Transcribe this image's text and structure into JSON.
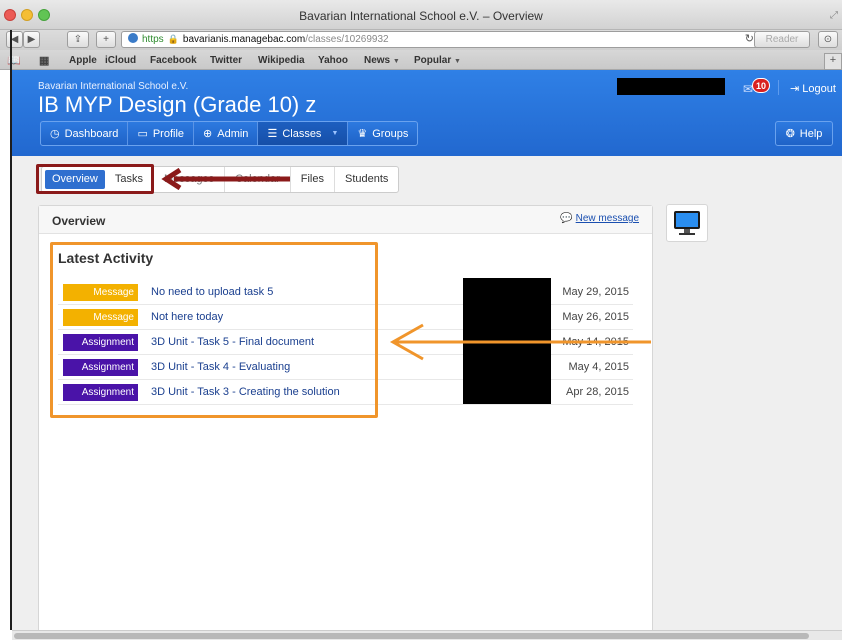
{
  "window": {
    "title": "Bavarian International School e.V. – Overview"
  },
  "toolbar": {
    "url_scheme": "https",
    "url_host": "bavarianis.managebac.com",
    "url_path": "/classes/10269932",
    "reader_label": "Reader"
  },
  "bookmarks": {
    "items": [
      {
        "label": "Apple"
      },
      {
        "label": "iCloud"
      },
      {
        "label": "Facebook"
      },
      {
        "label": "Twitter"
      },
      {
        "label": "Wikipedia"
      },
      {
        "label": "Yahoo"
      },
      {
        "label": "News"
      },
      {
        "label": "Popular"
      }
    ]
  },
  "header": {
    "school_name": "Bavarian International School e.V.",
    "class_title": "IB MYP Design (Grade 10) z",
    "mail_count": "10",
    "logout_label": "Logout",
    "help_label": "Help"
  },
  "nav": {
    "items": [
      {
        "label": "Dashboard",
        "icon": "dashboard-icon"
      },
      {
        "label": "Profile",
        "icon": "profile-card-icon"
      },
      {
        "label": "Admin",
        "icon": "globe-icon"
      },
      {
        "label": "Classes",
        "icon": "list-icon"
      },
      {
        "label": "Groups",
        "icon": "trophy-icon"
      }
    ]
  },
  "subtabs": {
    "items": [
      {
        "label": "Overview"
      },
      {
        "label": "Tasks"
      },
      {
        "label": "Messages"
      },
      {
        "label": "Calendar"
      },
      {
        "label": "Files"
      },
      {
        "label": "Students"
      }
    ]
  },
  "overview": {
    "title": "Overview",
    "new_message_label": "New message",
    "latest_title": "Latest Activity",
    "activities": [
      {
        "type": "Message",
        "title": "No need to upload task 5",
        "date": "May 29, 2015"
      },
      {
        "type": "Message",
        "title": "Not here today",
        "date": "May 26, 2015"
      },
      {
        "type": "Assignment",
        "title": "3D Unit - Task 5 - Final document",
        "date": "May 14, 2015"
      },
      {
        "type": "Assignment",
        "title": "3D Unit - Task 4 - Evaluating",
        "date": "May 4, 2015"
      },
      {
        "type": "Assignment",
        "title": "3D Unit - Task 3 - Creating the solution",
        "date": "Apr 28, 2015"
      }
    ]
  },
  "colors": {
    "header_blue": "#2268cf",
    "message_badge": "#f3b100",
    "assignment_badge": "#4a13a8",
    "annotation_red": "#8b1a1a",
    "annotation_orange": "#f0952b"
  }
}
